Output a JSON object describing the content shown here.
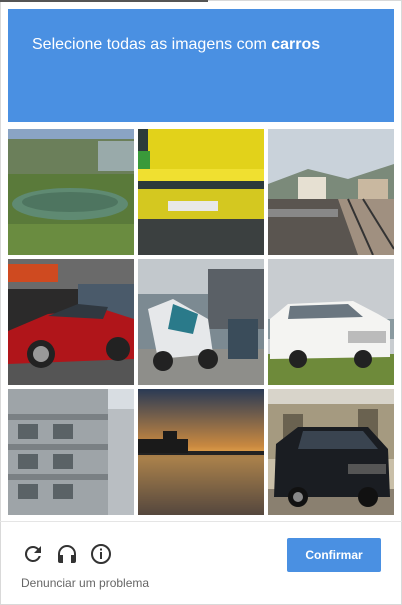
{
  "challenge": {
    "prompt_prefix": "Selecione todas as imagens com",
    "prompt_target": "carros",
    "header_color": "#4a90e2"
  },
  "tiles": [
    {
      "subject": "inflatable boat on grass",
      "icon": "boat-image"
    },
    {
      "subject": "yellow industrial machinery",
      "icon": "machinery-image"
    },
    {
      "subject": "railway tracks near town",
      "icon": "railway-image"
    },
    {
      "subject": "red sports car at night",
      "icon": "car-image"
    },
    {
      "subject": "motorcycles in parking lot",
      "icon": "motorcycle-image"
    },
    {
      "subject": "white limousine",
      "icon": "car-image"
    },
    {
      "subject": "apartment building facade",
      "icon": "building-image"
    },
    {
      "subject": "sunset over water with pier",
      "icon": "sunset-image"
    },
    {
      "subject": "black van near ruins",
      "icon": "car-image"
    }
  ],
  "footer": {
    "icons": [
      "reload-icon",
      "audio-icon",
      "info-icon"
    ],
    "confirm_label": "Confirmar",
    "report_label": "Denunciar um problema"
  }
}
